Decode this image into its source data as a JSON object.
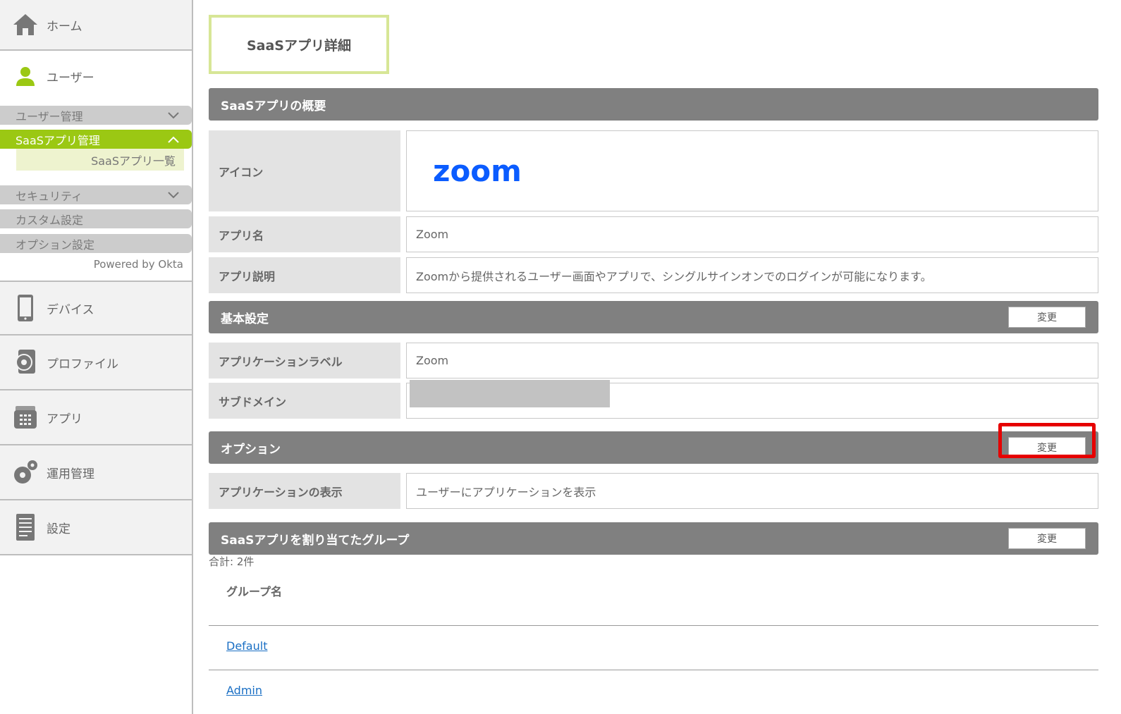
{
  "sidebar": {
    "home_label": "ホーム",
    "user_label": "ユーザー",
    "user_mgmt_label": "ユーザー管理",
    "saas_mgmt_label": "SaaSアプリ管理",
    "saas_list_label": "SaaSアプリ一覧",
    "security_label": "セキュリティ",
    "custom_label": "カスタム設定",
    "option_label": "オプション設定",
    "powered_by": "Powered by Okta",
    "device_label": "デバイス",
    "profile_label": "プロファイル",
    "app_label": "アプリ",
    "ops_label": "運用管理",
    "settings_label": "設定",
    "accent_color": "#9bc813"
  },
  "page": {
    "title": "SaaSアプリ詳細"
  },
  "overview": {
    "header": "SaaSアプリの概要",
    "icon_label": "アイコン",
    "logo_text": "zoom",
    "app_name_label": "アプリ名",
    "app_name_value": "Zoom",
    "app_desc_label": "アプリ説明",
    "app_desc_value": "Zoomから提供されるユーザー画面やアプリで、シングルサインオンでのログインが可能になります。"
  },
  "basic": {
    "header": "基本設定",
    "change_label": "変更",
    "label_label": "アプリケーションラベル",
    "label_value": "Zoom",
    "subdomain_label": "サブドメイン"
  },
  "options": {
    "header": "オプション",
    "change_label": "変更",
    "display_label": "アプリケーションの表示",
    "display_value": "ユーザーにアプリケーションを表示"
  },
  "groups": {
    "header": "SaaSアプリを割り当てたグループ",
    "change_label": "変更",
    "total": "合計: 2件",
    "column": "グループ名",
    "items": [
      "Default",
      "Admin"
    ]
  }
}
